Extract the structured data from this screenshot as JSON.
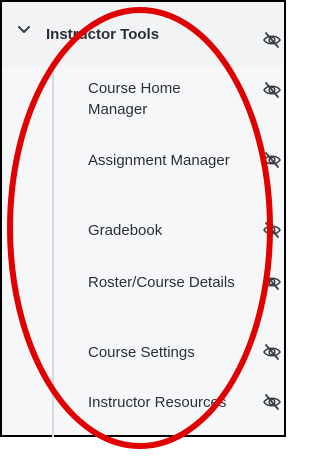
{
  "section": {
    "title": "Instructor Tools",
    "expanded": true
  },
  "items": [
    {
      "label": "Course Home Manager"
    },
    {
      "label": "Assignment Manager"
    },
    {
      "label": "Gradebook"
    },
    {
      "label": "Roster/Course Details"
    },
    {
      "label": "Course Settings"
    },
    {
      "label": "Instructor Resources"
    }
  ],
  "icons": {
    "chevron": "chevron-down-icon",
    "visibility": "eye-off-icon"
  },
  "colors": {
    "annotation": "#e00000",
    "text": "#2b2f36",
    "icon": "#3a3f47"
  }
}
